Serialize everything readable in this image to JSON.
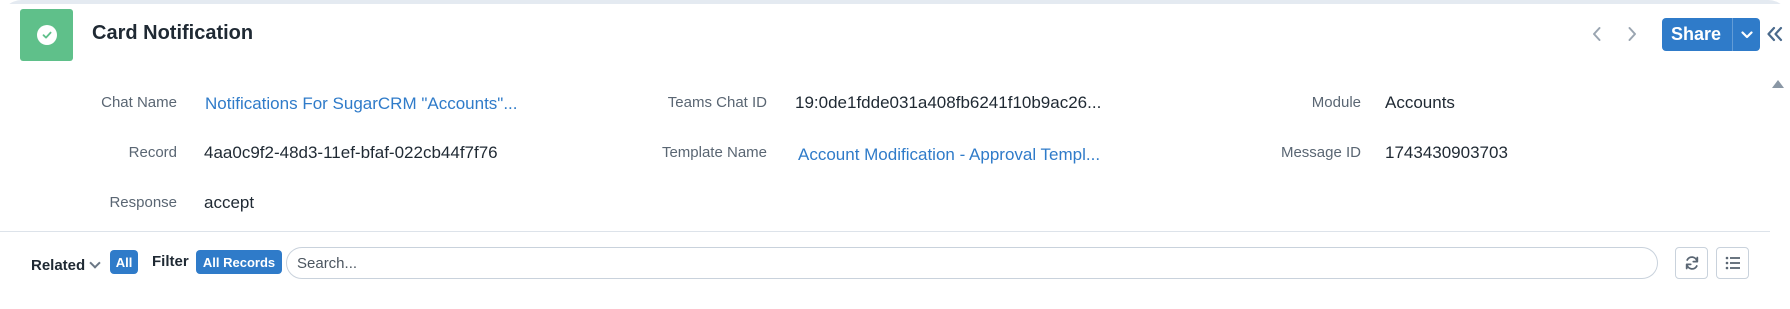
{
  "header": {
    "title": "Card Notification",
    "module_icon": "check-circle-icon",
    "module_color": "#5fc08a",
    "share_label": "Share",
    "prev_icon": "‹",
    "next_icon": "›",
    "collapse_icon": "«"
  },
  "fields": {
    "chat_name": {
      "label": "Chat Name",
      "value": "Notifications For SugarCRM \"Accounts\"..."
    },
    "teams_chat_id": {
      "label": "Teams Chat ID",
      "value": "19:0de1fdde031a408fb6241f10b9ac26..."
    },
    "module": {
      "label": "Module",
      "value": "Accounts"
    },
    "record": {
      "label": "Record",
      "value": "4aa0c9f2-48d3-11ef-bfaf-022cb44f7f76"
    },
    "template_name": {
      "label": "Template Name",
      "value": "Account Modification - Approval Templ..."
    },
    "message_id": {
      "label": "Message ID",
      "value": "1743430903703"
    },
    "response": {
      "label": "Response",
      "value": "accept"
    }
  },
  "related": {
    "label": "Related",
    "all_pill": "All",
    "filter_label": "Filter",
    "records_pill": "All Records",
    "search_placeholder": "Search..."
  },
  "colors": {
    "accent": "#2f7bc9",
    "link": "#2f7bc9",
    "module_green": "#5fc08a"
  }
}
